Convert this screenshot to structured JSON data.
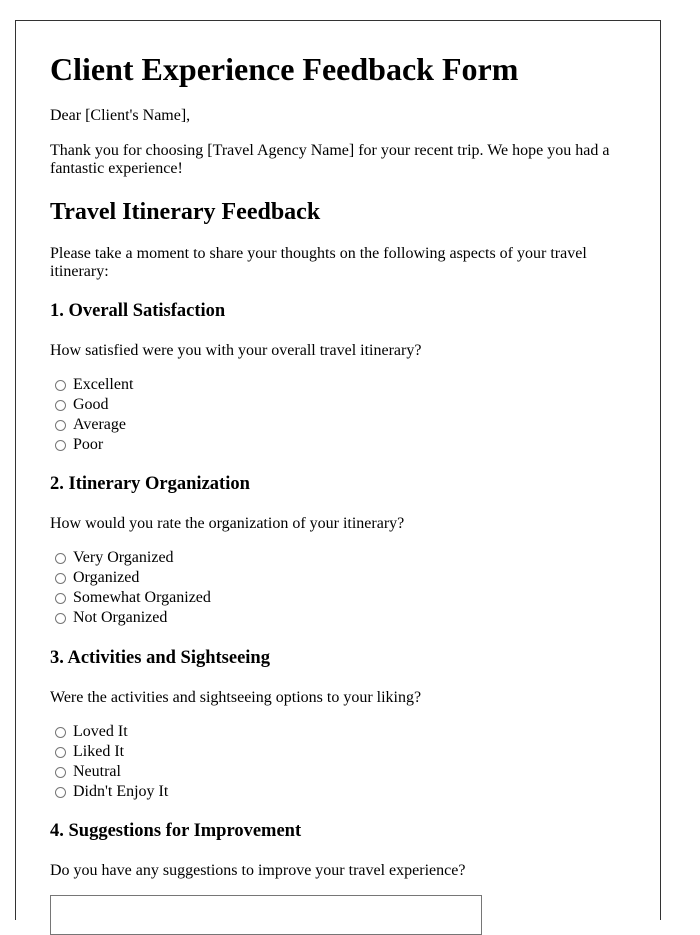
{
  "title": "Client Experience Feedback Form",
  "greeting": "Dear [Client's Name],",
  "intro": "Thank you for choosing [Travel Agency Name] for your recent trip. We hope you had a fantastic experience!",
  "section_title": "Travel Itinerary Feedback",
  "section_intro": "Please take a moment to share your thoughts on the following aspects of your travel itinerary:",
  "questions": [
    {
      "heading": "1. Overall Satisfaction",
      "prompt": "How satisfied were you with your overall travel itinerary?",
      "options": [
        "Excellent",
        "Good",
        "Average",
        "Poor"
      ]
    },
    {
      "heading": "2. Itinerary Organization",
      "prompt": "How would you rate the organization of your itinerary?",
      "options": [
        "Very Organized",
        "Organized",
        "Somewhat Organized",
        "Not Organized"
      ]
    },
    {
      "heading": "3. Activities and Sightseeing",
      "prompt": "Were the activities and sightseeing options to your liking?",
      "options": [
        "Loved It",
        "Liked It",
        "Neutral",
        "Didn't Enjoy It"
      ]
    },
    {
      "heading": "4. Suggestions for Improvement",
      "prompt": "Do you have any suggestions to improve your travel experience?"
    }
  ],
  "suggestions_value": ""
}
